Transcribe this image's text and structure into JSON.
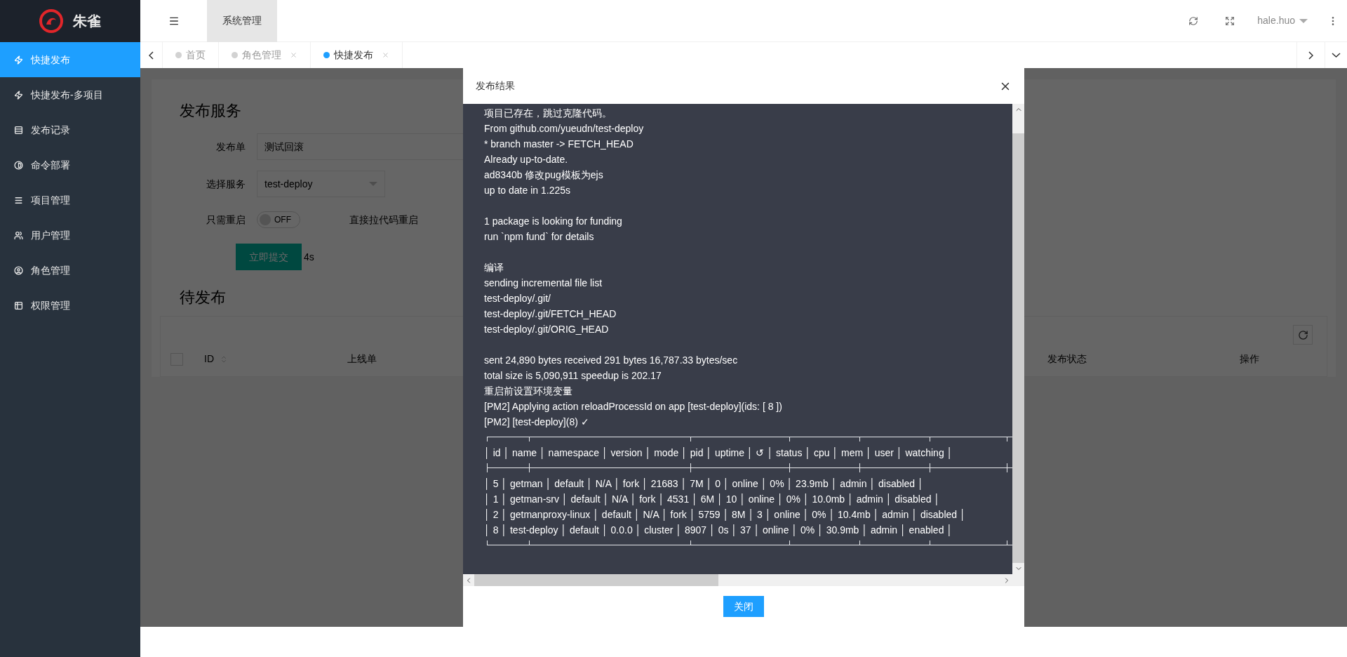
{
  "sidebar": {
    "logo_text": "朱雀",
    "items": [
      {
        "label": "快捷发布",
        "selected": true
      },
      {
        "label": "快捷发布-多项目",
        "selected": false
      },
      {
        "label": "发布记录",
        "selected": false
      },
      {
        "label": "命令部署",
        "selected": false
      },
      {
        "label": "项目管理",
        "selected": false
      },
      {
        "label": "用户管理",
        "selected": false
      },
      {
        "label": "角色管理",
        "selected": false
      },
      {
        "label": "权限管理",
        "selected": false
      }
    ]
  },
  "header": {
    "menu_tab": "系统管理",
    "user": "hale.huo"
  },
  "tabs": [
    {
      "label": "首页",
      "selected": false,
      "closable": false
    },
    {
      "label": "角色管理",
      "selected": false,
      "closable": true
    },
    {
      "label": "快捷发布",
      "selected": true,
      "closable": true
    }
  ],
  "page": {
    "title": "发布服务",
    "fields": [
      {
        "kind": "input",
        "label": "发布单",
        "value": "测试回滚"
      },
      {
        "kind": "select",
        "label": "选择服务",
        "value": "test-deploy"
      },
      {
        "kind": "switch",
        "label": "只需重启",
        "on": false,
        "state_text": "OFF",
        "hint": "直接拉代码重启"
      }
    ],
    "select_all_checked": false,
    "submit": "立即提交",
    "timer": "4s",
    "pending_title": "待发布",
    "table_columns": [
      "ID",
      "上线单",
      "发布状态",
      "操作"
    ]
  },
  "modal": {
    "title": "发布结果",
    "close_button": "关闭",
    "lines": [
      {
        "kind": "text",
        "text": "项目已存在，跳过克隆代码。"
      },
      {
        "kind": "text",
        "text": "From github.com/yueudn/test-deploy"
      },
      {
        "kind": "text",
        "text": "* branch master -> FETCH_HEAD"
      },
      {
        "kind": "text",
        "text": "Already up-to-date."
      },
      {
        "kind": "text",
        "text": "ad8340b 修改pug模板为ejs"
      },
      {
        "kind": "text",
        "text": "up to date in 1.225s"
      },
      {
        "kind": "blank"
      },
      {
        "kind": "text",
        "text": "1 package is looking for funding"
      },
      {
        "kind": "text",
        "text": "run `npm fund` for details"
      },
      {
        "kind": "blank"
      },
      {
        "kind": "text",
        "text": "编译"
      },
      {
        "kind": "text",
        "text": "sending incremental file list"
      },
      {
        "kind": "text",
        "text": "test-deploy/.git/"
      },
      {
        "kind": "text",
        "text": "test-deploy/.git/FETCH_HEAD"
      },
      {
        "kind": "text",
        "text": "test-deploy/.git/ORIG_HEAD"
      },
      {
        "kind": "blank"
      },
      {
        "kind": "text",
        "text": "sent 24,890 bytes received 291 bytes 16,787.33 bytes/sec"
      },
      {
        "kind": "text",
        "text": "total size is 5,090,911 speedup is 202.17"
      },
      {
        "kind": "text",
        "text": "重启前设置环境变量"
      },
      {
        "kind": "text",
        "text": "[PM2] Applying action reloadProcessId on app [test-deploy](ids: [ 8 ])"
      },
      {
        "kind": "text",
        "text": "[PM2] [test-deploy](8) ✓"
      },
      {
        "kind": "top_rule"
      },
      {
        "kind": "text",
        "text": "│ id │ name │ namespace │ version │ mode │ pid │ uptime │ ↺ │ status │ cpu │ mem │ user │ watching │"
      },
      {
        "kind": "mid_rule"
      },
      {
        "kind": "text",
        "text": "│ 5 │ getman │ default │ N/A │ fork │ 21683 │ 7M │ 0 │ online │ 0% │ 23.9mb │ admin │ disabled │"
      },
      {
        "kind": "text",
        "text": "│ 1 │ getman-srv │ default │ N/A │ fork │ 4531 │ 6M │ 10 │ online │ 0% │ 10.0mb │ admin │ disabled │"
      },
      {
        "kind": "text",
        "text": "│ 2 │ getmanproxy-linux │ default │ N/A │ fork │ 5759 │ 8M │ 3 │ online │ 0% │ 10.4mb │ admin │ disabled │"
      },
      {
        "kind": "text",
        "text": "│ 8 │ test-deploy │ default │ 0.0.0 │ cluster │ 8907 │ 0s │ 37 │ online │ 0% │ 30.9mb │ admin │ enabled │"
      },
      {
        "kind": "bottom_rule"
      }
    ]
  }
}
